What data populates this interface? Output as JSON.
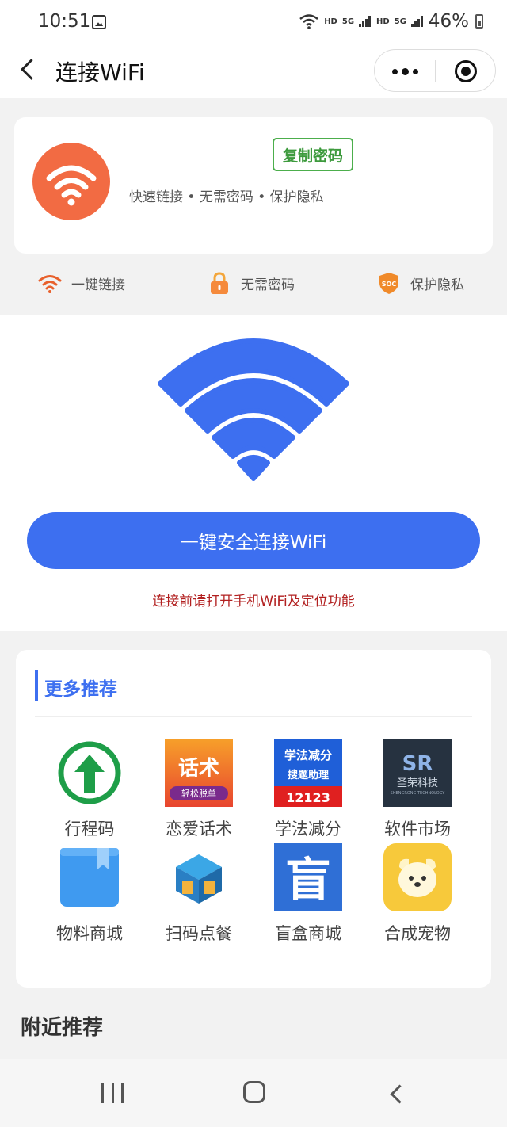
{
  "status_bar": {
    "time": "10:51",
    "net1": "HD",
    "net2": "5G",
    "net3": "HD",
    "net4": "5G",
    "battery": "46%"
  },
  "nav": {
    "title": "连接WiFi"
  },
  "info_card": {
    "copy_label": "复制密码",
    "tagline": "快速链接 • 无需密码 • 保护隐私"
  },
  "features": [
    {
      "label": "一键链接",
      "icon": "wifi-icon"
    },
    {
      "label": "无需密码",
      "icon": "lock-icon"
    },
    {
      "label": "保护隐私",
      "icon": "shield-icon"
    }
  ],
  "shield_text": "SOC",
  "main": {
    "connect_label": "一键安全连接WiFi",
    "tip": "连接前请打开手机WiFi及定位功能"
  },
  "recommend": {
    "title": "更多推荐",
    "items": [
      {
        "label": "行程码",
        "icon": "itinerary-code-icon"
      },
      {
        "label": "恋爱话术",
        "icon": "love-talk-icon",
        "badge_main": "话术",
        "badge_sub": "轻松脱单"
      },
      {
        "label": "学法减分",
        "icon": "traffic-law-icon",
        "badge_main": "学法减分",
        "badge_mid": "搜题助理",
        "badge_num": "12123"
      },
      {
        "label": "软件市场",
        "icon": "software-market-icon",
        "badge_main": "SR",
        "badge_cn": "圣荣科技",
        "badge_en": "SHENGRONG TECHNOLOGY"
      },
      {
        "label": "物料商城",
        "icon": "material-mall-icon"
      },
      {
        "label": "扫码点餐",
        "icon": "scan-order-icon"
      },
      {
        "label": "盲盒商城",
        "icon": "blind-box-icon",
        "badge_main": "盲"
      },
      {
        "label": "合成宠物",
        "icon": "pet-icon"
      }
    ]
  },
  "nearby": {
    "title": "附近推荐"
  },
  "colors": {
    "accent_blue": "#3d6ff0",
    "wifi_orange": "#f26b43",
    "copy_green": "#4cae4c",
    "tip_red": "#b22020"
  }
}
